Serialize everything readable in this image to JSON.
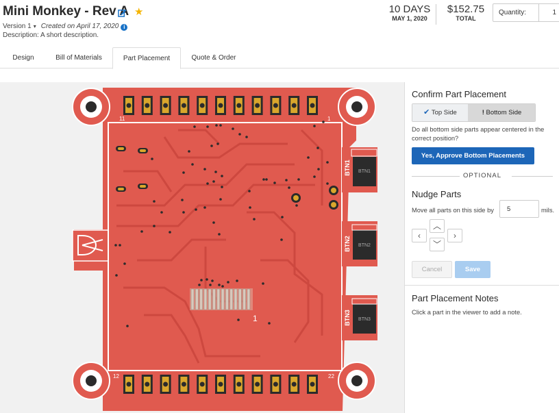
{
  "header": {
    "title": "Mini Monkey - Rev A",
    "version": "Version 1",
    "created": "Created on April 17, 2020",
    "description": "Description: A short description.",
    "lead_time": "10 DAYS",
    "ship_date": "MAY 1, 2020",
    "total_price": "$152.75",
    "total_label": "TOTAL",
    "quantity_label": "Quantity:",
    "quantity_value": "1"
  },
  "tabs": [
    {
      "label": "Design",
      "active": false
    },
    {
      "label": "Bill of Materials",
      "active": false
    },
    {
      "label": "Part Placement",
      "active": true
    },
    {
      "label": "Quote & Order",
      "active": false
    }
  ],
  "board": {
    "silk_labels": {
      "btn1": "BTN1",
      "btn2": "BTN2",
      "btn3": "BTN3",
      "pin11": "11",
      "pin12": "12",
      "pin22": "22",
      "conn_pin1": "1",
      "corner_1": "1"
    },
    "part_labels": {
      "btn1": "BTN1",
      "btn2": "BTN2",
      "btn3": "BTN3"
    },
    "colors": {
      "copper": "#e05a4f",
      "pad": "#d9a62c",
      "bg": "#f1f1f1",
      "hole": "#2b2b2b",
      "trace": "#c9443c",
      "outline": "#ffffff"
    }
  },
  "panel": {
    "confirm_title": "Confirm Part Placement",
    "top_side_label": "Top Side",
    "bottom_side_label": "Bottom Side",
    "question": "Do all bottom side parts appear centered in the correct position?",
    "approve_label": "Yes, Approve Bottom Placements",
    "optional_label": "OPTIONAL",
    "nudge_title": "Nudge Parts",
    "nudge_prefix": "Move all parts on this side by",
    "nudge_value": "5",
    "nudge_unit": "mils.",
    "cancel_label": "Cancel",
    "save_label": "Save",
    "notes_title": "Part Placement Notes",
    "notes_hint": "Click a part in the viewer to add a note.",
    "accent_color": "#1d66b8"
  }
}
